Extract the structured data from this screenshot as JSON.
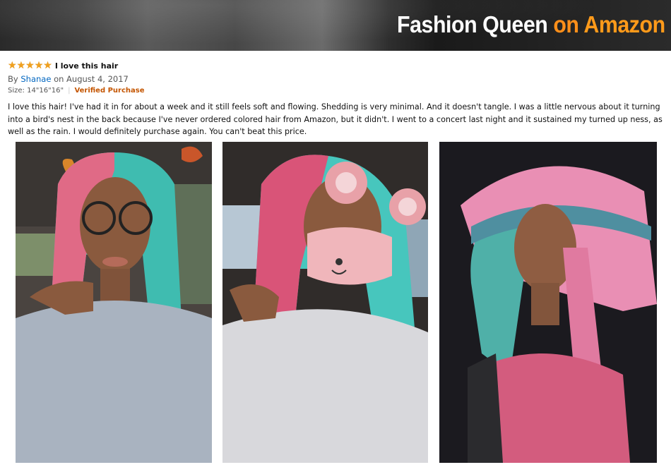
{
  "banner": {
    "title_part1": "Fashion Queen",
    "title_part2": "on",
    "title_part3": "Amazon"
  },
  "review": {
    "rating": 5,
    "headline": "I love this hair",
    "by_prefix": "By",
    "author": "Shanae",
    "date_text": "on August 4, 2017",
    "size_text": "Size: 14\"16\"16\"",
    "separator": "|",
    "verified": "Verified Purchase",
    "body": "I love this hair! I've had it in for about a week and it still feels soft and flowing. Shedding is very minimal. And it doesn't tangle. I was a little nervous about it turning into a bird's nest in the back because I've never ordered colored hair from Amazon, but it didn't. I went to a concert last night and it sustained my turned up ness, as well as the rain. I would definitely purchase again. You can't beat this price."
  },
  "photos": [
    {
      "name": "customer-photo-1"
    },
    {
      "name": "customer-photo-2"
    },
    {
      "name": "customer-photo-3"
    }
  ],
  "colors": {
    "star": "#f0a01e",
    "author_link": "#0066c0",
    "verified": "#c45500",
    "banner_accent": "#ff8f1a"
  }
}
